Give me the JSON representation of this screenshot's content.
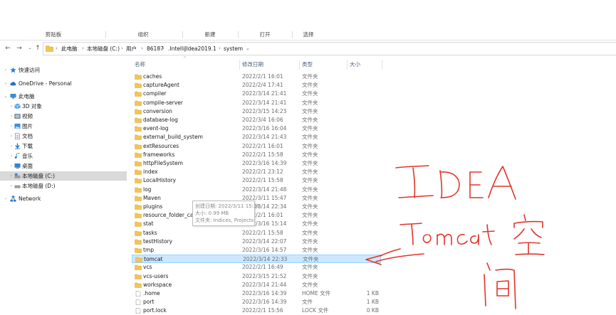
{
  "ribbon": {
    "groups": [
      "剪贴板",
      "组织",
      "新建",
      "打开",
      "选择"
    ]
  },
  "address": {
    "crumbs": [
      "此电脑",
      "本地磁盘 (C:)",
      "用户",
      "86187",
      ".IntelliJIdea2019.1",
      "system"
    ]
  },
  "nav": {
    "items": [
      {
        "label": "快速访问",
        "icon": "star-icon"
      },
      {
        "label": "OneDrive - Personal",
        "icon": "cloud-icon"
      },
      {
        "label": "此电脑",
        "icon": "computer-icon"
      },
      {
        "label": "3D 对象",
        "icon": "cube-icon"
      },
      {
        "label": "视频",
        "icon": "video-icon"
      },
      {
        "label": "图片",
        "icon": "picture-icon"
      },
      {
        "label": "文档",
        "icon": "document-icon"
      },
      {
        "label": "下载",
        "icon": "download-icon"
      },
      {
        "label": "音乐",
        "icon": "music-icon"
      },
      {
        "label": "桌面",
        "icon": "desktop-icon"
      },
      {
        "label": "本地磁盘 (C:)",
        "icon": "drive-icon"
      },
      {
        "label": "本地磁盘 (D:)",
        "icon": "drive-icon"
      },
      {
        "label": "Network",
        "icon": "network-icon"
      }
    ]
  },
  "columns": {
    "name": "名称",
    "date": "修改日期",
    "type": "类型",
    "size": "大小"
  },
  "files": [
    {
      "name": "caches",
      "date": "2022/2/1 16:01",
      "type": "文件夹",
      "size": ""
    },
    {
      "name": "captureAgent",
      "date": "2022/2/4 17:41",
      "type": "文件夹",
      "size": ""
    },
    {
      "name": "compiler",
      "date": "2022/3/14 21:41",
      "type": "文件夹",
      "size": ""
    },
    {
      "name": "compile-server",
      "date": "2022/3/14 21:41",
      "type": "文件夹",
      "size": ""
    },
    {
      "name": "conversion",
      "date": "2022/3/15 14:23",
      "type": "文件夹",
      "size": ""
    },
    {
      "name": "database-log",
      "date": "2022/3/4 16:06",
      "type": "文件夹",
      "size": ""
    },
    {
      "name": "event-log",
      "date": "2022/3/16 16:04",
      "type": "文件夹",
      "size": ""
    },
    {
      "name": "external_build_system",
      "date": "2022/3/14 21:43",
      "type": "文件夹",
      "size": ""
    },
    {
      "name": "extResources",
      "date": "2022/2/1 16:01",
      "type": "文件夹",
      "size": ""
    },
    {
      "name": "frameworks",
      "date": "2022/2/1 15:58",
      "type": "文件夹",
      "size": ""
    },
    {
      "name": "httpFileSystem",
      "date": "2022/3/16 14:39",
      "type": "文件夹",
      "size": ""
    },
    {
      "name": "index",
      "date": "2022/2/1 23:12",
      "type": "文件夹",
      "size": ""
    },
    {
      "name": "LocalHistory",
      "date": "2022/2/1 15:58",
      "type": "文件夹",
      "size": ""
    },
    {
      "name": "log",
      "date": "2022/3/14 21:48",
      "type": "文件夹",
      "size": ""
    },
    {
      "name": "Maven",
      "date": "2022/3/11 15:47",
      "type": "文件夹",
      "size": ""
    },
    {
      "name": "plugins",
      "date": "2022/3/14 22:34",
      "type": "文件夹",
      "size": ""
    },
    {
      "name": "resource_folder_cache",
      "date": "2022/2/1 16:01",
      "type": "文件夹",
      "size": ""
    },
    {
      "name": "stat",
      "date": "2022/3/16 15:14",
      "type": "文件夹",
      "size": ""
    },
    {
      "name": "tasks",
      "date": "2022/2/1 15:58",
      "type": "文件夹",
      "size": ""
    },
    {
      "name": "testHistory",
      "date": "2022/3/14 22:07",
      "type": "文件夹",
      "size": ""
    },
    {
      "name": "tmp",
      "date": "2022/3/16 14:57",
      "type": "文件夹",
      "size": ""
    },
    {
      "name": "tomcat",
      "date": "2022/3/14 22:33",
      "type": "文件夹",
      "size": ""
    },
    {
      "name": "vcs",
      "date": "2022/2/1 16:49",
      "type": "文件夹",
      "size": ""
    },
    {
      "name": "vcs-users",
      "date": "2022/3/15 21:52",
      "type": "文件夹",
      "size": ""
    },
    {
      "name": "workspace",
      "date": "2022/3/14 21:44",
      "type": "文件夹",
      "size": ""
    },
    {
      "name": ".home",
      "date": "2022/3/16 14:39",
      "type": "HOME 文件",
      "size": "1 KB"
    },
    {
      "name": "port",
      "date": "2022/3/16 14:39",
      "type": "文件",
      "size": "1 KB"
    },
    {
      "name": "port.lock",
      "date": "2022/2/1 15:56",
      "type": "LOCK 文件",
      "size": "0 KB"
    }
  ],
  "selected_row": "tomcat",
  "tooltip": {
    "line1": "创建日期: 2022/3/11 15:39",
    "line2": "大小: 0.99 MB",
    "line3": "文件夹: Indices, Projects"
  },
  "colors": {
    "selection": "#cce8ff",
    "folder": "#f3c456",
    "annotation": "#e0352b"
  }
}
